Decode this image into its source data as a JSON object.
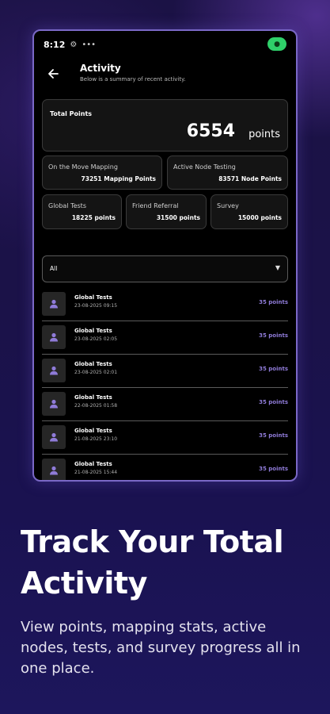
{
  "status_bar": {
    "time": "8:12",
    "icons": [
      "settings-icon",
      "dots-icon"
    ],
    "location_icon": "location-pin-icon"
  },
  "header": {
    "title": "Activity",
    "subtitle": "Below is a summary of recent activity."
  },
  "total": {
    "label": "Total Points",
    "value": "6554",
    "unit": "points"
  },
  "stats": [
    {
      "label": "On the Move Mapping",
      "value": "73251 Mapping Points"
    },
    {
      "label": "Active Node Testing",
      "value": "83571 Node Points"
    },
    {
      "label": "Global Tests",
      "value": "18225 points"
    },
    {
      "label": "Friend Referral",
      "value": "31500 points"
    },
    {
      "label": "Survey",
      "value": "15000 points"
    }
  ],
  "filter": {
    "selected": "All"
  },
  "activities": [
    {
      "name": "Global Tests",
      "date": "23-08-2025 09:15",
      "points": "35 points"
    },
    {
      "name": "Global Tests",
      "date": "23-08-2025 02:05",
      "points": "35 points"
    },
    {
      "name": "Global Tests",
      "date": "23-08-2025 02:01",
      "points": "35 points"
    },
    {
      "name": "Global Tests",
      "date": "22-08-2025 01:58",
      "points": "35 points"
    },
    {
      "name": "Global Tests",
      "date": "21-08-2025 23:10",
      "points": "35 points"
    },
    {
      "name": "Global Tests",
      "date": "21-08-2025 15:44",
      "points": "35 points"
    }
  ],
  "promo": {
    "headline": "Track Your Total Activity",
    "description": "View points, mapping stats, active nodes, tests, and survey progress all in one place."
  },
  "colors": {
    "accent": "#8f7bd8",
    "location_pill": "#2fd06a",
    "frame_border": "#7a68c6"
  }
}
